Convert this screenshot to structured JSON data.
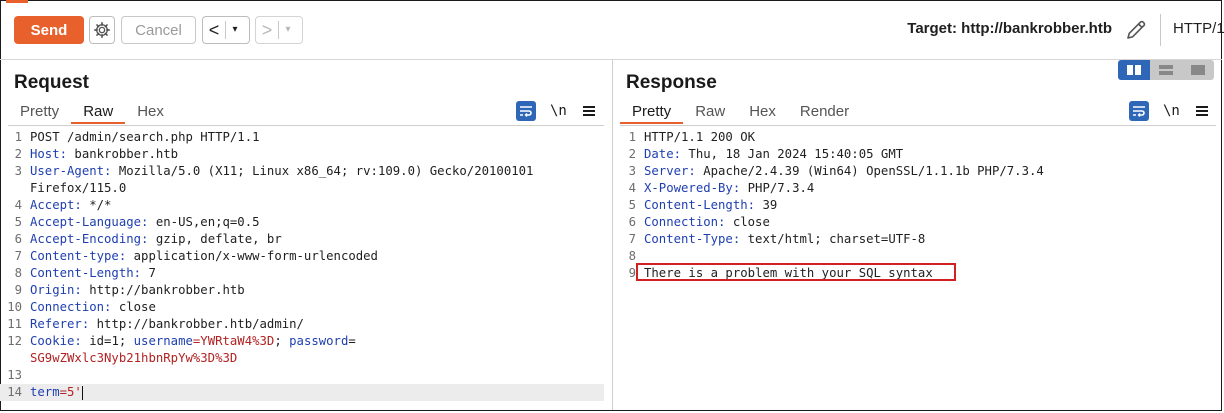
{
  "toolbar": {
    "send_label": "Send",
    "cancel_label": "Cancel",
    "back_arrow": "<",
    "forward_arrow": ">",
    "dropdown_glyph": "▾",
    "target_label": "Target: http://bankrobber.htb",
    "http_version_label": "HTTP/1"
  },
  "request": {
    "title": "Request",
    "tabs": [
      "Pretty",
      "Raw",
      "Hex"
    ],
    "active_tab": "Raw",
    "newline_toggle": "\\n",
    "lines": [
      {
        "n": "1",
        "k": "",
        "v": "POST /admin/search.php HTTP/1.1"
      },
      {
        "n": "2",
        "k": "Host:",
        "v": " bankrobber.htb"
      },
      {
        "n": "3",
        "k": "User-Agent:",
        "v": " Mozilla/5.0 (X11; Linux x86_64; rv:109.0) Gecko/20100101"
      },
      {
        "n": "",
        "k": "",
        "v": "Firefox/115.0"
      },
      {
        "n": "4",
        "k": "Accept:",
        "v": " */*"
      },
      {
        "n": "5",
        "k": "Accept-Language:",
        "v": " en-US,en;q=0.5"
      },
      {
        "n": "6",
        "k": "Accept-Encoding:",
        "v": " gzip, deflate, br"
      },
      {
        "n": "7",
        "k": "Content-type:",
        "v": " application/x-www-form-urlencoded"
      },
      {
        "n": "8",
        "k": "Content-Length:",
        "v": " 7"
      },
      {
        "n": "9",
        "k": "Origin:",
        "v": " http://bankrobber.htb"
      },
      {
        "n": "10",
        "k": "Connection:",
        "v": " close"
      },
      {
        "n": "11",
        "k": "Referer:",
        "v": " http://bankrobber.htb/admin/"
      },
      {
        "n": "12",
        "k": "Cookie:",
        "v": " id=1; ",
        "k2": "username",
        "v2": "=YWRtaW4%3D",
        "s2": "; ",
        "k3": "password",
        "v3": "="
      },
      {
        "n": "",
        "k": "",
        "v": "",
        "red": "SG9wZWxlc3Nyb21hbnRpYw%3D%3D"
      },
      {
        "n": "13",
        "k": "",
        "v": ""
      },
      {
        "n": "14",
        "k": "term",
        "v": "",
        "red": "=5'"
      }
    ]
  },
  "response": {
    "title": "Response",
    "tabs": [
      "Pretty",
      "Raw",
      "Hex",
      "Render"
    ],
    "active_tab": "Pretty",
    "newline_toggle": "\\n",
    "lines": [
      {
        "n": "1",
        "k": "",
        "v": "HTTP/1.1 200 OK"
      },
      {
        "n": "2",
        "k": "Date:",
        "v": " Thu, 18 Jan 2024 15:40:05 GMT"
      },
      {
        "n": "3",
        "k": "Server:",
        "v": " Apache/2.4.39 (Win64) OpenSSL/1.1.1b PHP/7.3.4"
      },
      {
        "n": "4",
        "k": "X-Powered-By:",
        "v": " PHP/7.3.4"
      },
      {
        "n": "5",
        "k": "Content-Length:",
        "v": " 39"
      },
      {
        "n": "6",
        "k": "Connection:",
        "v": " close"
      },
      {
        "n": "7",
        "k": "Content-Type:",
        "v": " text/html; charset=UTF-8"
      },
      {
        "n": "8",
        "k": "",
        "v": ""
      },
      {
        "n": "9",
        "k": "",
        "v": "There is a problem with your SQL syntax"
      }
    ]
  },
  "colors": {
    "accent": "#e8612c",
    "key": "#1f3fb0",
    "value_red": "#b22222",
    "highlight_box": "#d32020",
    "active_blue": "#2f67b8"
  }
}
